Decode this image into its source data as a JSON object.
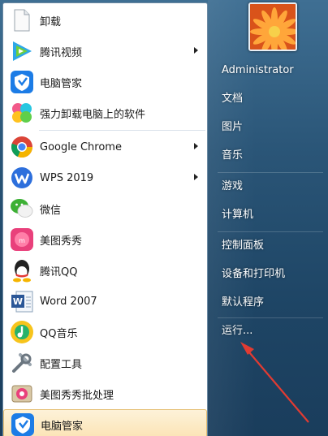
{
  "start_menu": {
    "programs": [
      {
        "label": "卸载",
        "icon": "document-icon",
        "submenu": false
      },
      {
        "label": "腾讯视频",
        "icon": "tencent-video-icon",
        "submenu": true
      },
      {
        "label": "电脑管家",
        "icon": "pc-manager-icon",
        "submenu": false
      },
      {
        "label": "强力卸载电脑上的软件",
        "icon": "uninstaller-icon",
        "submenu": false
      },
      {
        "label": "Google Chrome",
        "icon": "chrome-icon",
        "submenu": true
      },
      {
        "label": "WPS 2019",
        "icon": "wps-icon",
        "submenu": true
      },
      {
        "label": "微信",
        "icon": "wechat-icon",
        "submenu": false
      },
      {
        "label": "美图秀秀",
        "icon": "meitu-icon",
        "submenu": false
      },
      {
        "label": "腾讯QQ",
        "icon": "qq-icon",
        "submenu": false
      },
      {
        "label": "Word 2007",
        "icon": "word-icon",
        "submenu": false
      },
      {
        "label": "QQ音乐",
        "icon": "qq-music-icon",
        "submenu": false
      },
      {
        "label": "配置工具",
        "icon": "tools-icon",
        "submenu": false
      },
      {
        "label": "美图秀秀批处理",
        "icon": "meitu-batch-icon",
        "submenu": false
      },
      {
        "label": "电脑管家",
        "icon": "pc-manager-icon",
        "submenu": false,
        "highlighted": true
      }
    ],
    "user": {
      "name": "Administrator",
      "avatar_icon": "flower-avatar-icon"
    },
    "places": [
      {
        "label": "文档"
      },
      {
        "label": "图片"
      },
      {
        "label": "音乐"
      },
      {
        "label": "游戏"
      },
      {
        "label": "计算机"
      },
      {
        "label": "控制面板"
      },
      {
        "label": "设备和打印机"
      },
      {
        "label": "默认程序"
      },
      {
        "label": "运行..."
      }
    ]
  },
  "annotation": {
    "icon": "red-arrow-icon",
    "color": "#e23b32",
    "points_to": "运行..."
  }
}
